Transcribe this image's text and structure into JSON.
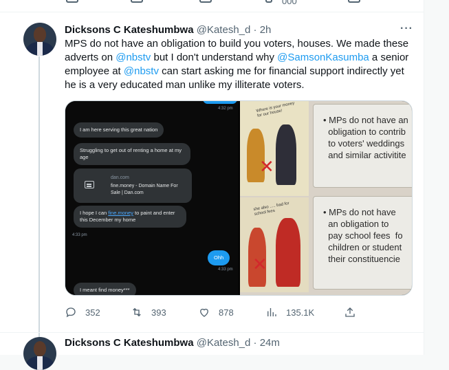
{
  "previous_tweet": {
    "partial_count": "000"
  },
  "tweet": {
    "author_name": "Dicksons C Kateshumbwa",
    "handle": "@Katesh_d",
    "separator": "·",
    "time": "2h",
    "more": "···",
    "text_parts": [
      "MPS do not have an obligation to build you voters, houses. We made these adverts on ",
      "@nbstv",
      "  but I don't understand why ",
      "@SamsonKasumba",
      " a senior employee at ",
      "@nbstv",
      " can start asking me for financial support indirectly yet he is a very educated man unlike my illiterate voters."
    ],
    "stats": {
      "replies": "352",
      "retweets": "393",
      "likes": "878",
      "views": "135.1K"
    }
  },
  "chat_screenshot": {
    "ts_top": "4:32 pm",
    "msg1": "I am here serving this great nation",
    "msg2": "Struggling to get out of renting a home at my age",
    "link_domain": "dan.com",
    "link_title": "fine.money - Domain Name For Sale | Dan.com",
    "msg3_pre": "I hope I can ",
    "msg3_link": "fine.money",
    "msg3_post": " to paint and enter this December my home",
    "ts_left": "4:33 pm",
    "msg_me": "Ohh",
    "ts_right": "4:33 pm",
    "msg4": "I meant find money***"
  },
  "poster": {
    "caption_top": "Where is your money for our house!",
    "caption_bottom": "she also ..... bad for school fees",
    "panel1": "• MPs do not have an\n  obligation to contrib\n  to voters' weddings\n  and similar activitite",
    "panel2": "• MPs do not have\n  an obligation to\n  pay school fees  fo\n  children or student\n  their constituencie"
  },
  "next_tweet": {
    "author_name": "Dicksons C Kateshumbwa",
    "handle": "@Katesh_d",
    "separator": "·",
    "time": "24m"
  },
  "colors": {
    "accent": "#1d9bf0",
    "muted": "#536471",
    "text": "#0f1419"
  }
}
